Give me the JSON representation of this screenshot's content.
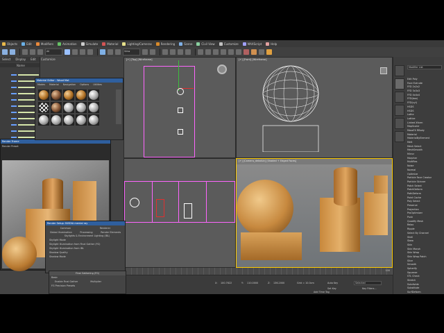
{
  "colors": {
    "accent": "#2f5f9e",
    "select": "#ff00ff",
    "wire": "#ffffff",
    "wood": "#c7893f",
    "gizmo": "#ffcc00"
  },
  "menubar": {
    "items": [
      {
        "label": "Objects",
        "color": "#e9b94a"
      },
      {
        "label": "Edit",
        "color": "#6ab0e6"
      },
      {
        "label": "Modifiers",
        "color": "#ea8a3c"
      },
      {
        "label": "Animation",
        "color": "#66c166"
      },
      {
        "label": "Simulate",
        "color": "#cccccc"
      },
      {
        "label": "Material",
        "color": "#d35454"
      },
      {
        "label": "Lighting/Cameras",
        "color": "#e6e08a"
      },
      {
        "label": "Rendering",
        "color": "#d88a2a"
      },
      {
        "label": "Scene",
        "color": "#7fb0e6"
      },
      {
        "label": "Civil View",
        "color": "#8ad0a0"
      },
      {
        "label": "Customize",
        "color": "#c0c0c0"
      },
      {
        "label": "MAXScript",
        "color": "#a0a0ff"
      },
      {
        "label": "Help",
        "color": "#e0a0a0"
      }
    ]
  },
  "toolbar": {
    "filter_select": "All",
    "view_select": "View"
  },
  "explorer": {
    "tabs": [
      "Select",
      "Display",
      "Edit",
      "Customize"
    ],
    "columns": [
      "Name",
      "Color",
      "Ray Material"
    ]
  },
  "material_editor": {
    "title": "Material Editor - Wood Mat",
    "menu": [
      "Modes",
      "Material",
      "Navigation",
      "Options",
      "Utilities"
    ]
  },
  "render_frame": {
    "title": "Render Frame",
    "preset": "Render Preset"
  },
  "render_setup": {
    "title": "Render Setup: NVIDIA mental ray",
    "tabs_row1": [
      "Common",
      "Renderer"
    ],
    "tabs_row2": [
      "Global Illumination",
      "Processing",
      "Render Elements"
    ],
    "section": "Skylights & Environment Lighting (IBL)",
    "rows": [
      "Skylight Mode",
      "Skylight Illumination from Final Gather (FG)",
      "Skylight Illumination from IBL",
      "Shadow Quality",
      "Shadow Mode"
    ],
    "fg_title": "Final Gathering (FG)",
    "fg_rows": [
      "Basic",
      "Enable Final Gather",
      "FG Precision Presets"
    ],
    "multiplier_label": "Multiplier"
  },
  "viewports": {
    "top_left": "[+] [Top] [Wireframe]",
    "top_right": "[+] [Front] [Wireframe]",
    "persp": "[+] [Camera_detailLit] [Shaded + Edged Faces]"
  },
  "command_panel": {
    "header": "Modifier List",
    "items": [
      "Edit Poly",
      "Face Extrude",
      "FFD 2x2x2",
      "FFD 3x3x3",
      "FFD 4x4x4",
      "FFD(box)",
      "FFD(cyl)",
      "HSDS",
      "HSDS",
      "Lathe",
      "Lattice",
      "Linked Xform",
      "MapScaler",
      "MassFX RBody",
      "Material",
      "MaterialByElement",
      "Melt",
      "Mesh Select",
      "MeshSmooth",
      "Mirror",
      "Morpher",
      "MultiRes",
      "Noise",
      "Normal",
      "Optimize",
      "Particle Face Creator",
      "Particle Skinner",
      "Patch Select",
      "PatchDeform",
      "PathDeform",
      "Point Cache",
      "Poly Select",
      "Preserve",
      "Projection",
      "ProOptimizer",
      "Push",
      "Quadify Mesh",
      "Relax",
      "Ripple",
      "Select By Channel",
      "Shell",
      "Skew",
      "Skin",
      "Skin Morph",
      "Skin Wrap",
      "Skin Wrap Patch",
      "Slice",
      "Smooth",
      "Spherify",
      "Squeeze",
      "STL Check",
      "Stretch",
      "Subdivide",
      "Substitute",
      "SurfDeform",
      "Symmetry",
      "Taper"
    ]
  },
  "status": {
    "x_label": "X:",
    "x_val": "100.7622",
    "y_label": "Y:",
    "y_val": "110.0000",
    "z_label": "Z:",
    "z_val": "136.2000",
    "grid": "Grid = 10.0cm",
    "auto_key": "Auto Key",
    "set_key": "Set Key",
    "key_filters": "Key Filters...",
    "selected": "Selected",
    "add_time_tag": "Add Time Tag",
    "timeline_end": "100",
    "frame": "0 / 100"
  }
}
